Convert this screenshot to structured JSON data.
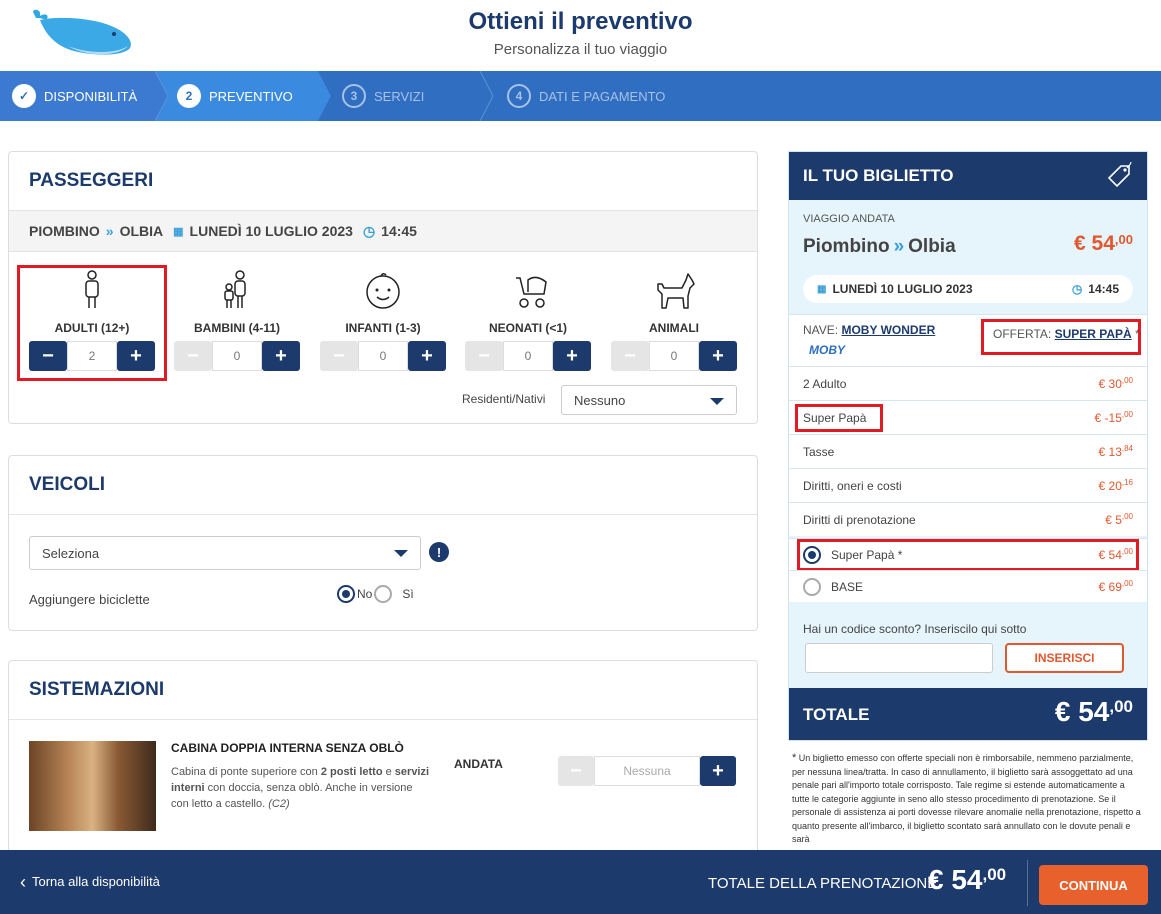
{
  "header": {
    "title": "Ottieni il preventivo",
    "subtitle": "Personalizza il tuo viaggio",
    "logo_icon": "whale-logo"
  },
  "steps": [
    {
      "num": "✓",
      "label": "DISPONIBILITÀ"
    },
    {
      "num": "2",
      "label": "PREVENTIVO"
    },
    {
      "num": "3",
      "label": "SERVIZI"
    },
    {
      "num": "4",
      "label": "DATI E PAGAMENTO"
    }
  ],
  "passengers": {
    "title": "PASSEGGERI",
    "route": {
      "from": "PIOMBINO",
      "to": "OLBIA",
      "date": "LUNEDÌ 10 LUGLIO 2023",
      "time": "14:45"
    },
    "types": [
      {
        "label": "ADULTI (12+)",
        "value": "2"
      },
      {
        "label": "BAMBINI (4-11)",
        "value": "0"
      },
      {
        "label": "INFANTI (1-3)",
        "value": "0"
      },
      {
        "label": "NEONATI (<1)",
        "value": "0"
      },
      {
        "label": "ANIMALI",
        "value": "0"
      }
    ],
    "residents_label": "Residenti/Nativi",
    "residents_value": "Nessuno"
  },
  "vehicles": {
    "title": "VEICOLI",
    "select_value": "Seleziona",
    "bikes_label": "Aggiungere biciclette",
    "no": "No",
    "si": "Sì"
  },
  "accommodations": {
    "title": "SISTEMAZIONI",
    "cabin_title": "CABINA DOPPIA INTERNA SENZA OBLÒ",
    "desc1": "Cabina di ponte superiore con ",
    "desc_b1": "2 posti letto",
    "desc2": " e ",
    "desc_b2": "servizi interni",
    "desc3": " con doccia, senza oblò. Anche in versione con letto a castello. ",
    "desc_code": "(C2)",
    "andata": "ANDATA",
    "select_value": "Nessuna"
  },
  "ticket": {
    "title": "IL TUO BIGLIETTO",
    "trip_label": "VIAGGIO ANDATA",
    "from": "Piombino",
    "to": "Olbia",
    "price_int": "€ 54",
    "price_dec": ",00",
    "date": "LUNEDÌ 10 LUGLIO 2023",
    "time": "14:45",
    "ship_label": "NAVE:",
    "ship_name": "MOBY WONDER",
    "brand": "MOBY",
    "offer_label": "OFFERTA:",
    "offer_name": "SUPER PAPÀ",
    "offer_star": "*",
    "lines": [
      {
        "label": "2 Adulto",
        "int": "€ 30",
        "dec": ",00"
      },
      {
        "label": "Super Papà",
        "int": "€ -15",
        "dec": ",00"
      },
      {
        "label": "Tasse",
        "int": "€ 13",
        "dec": ",84"
      },
      {
        "label": "Diritti, oneri e costi",
        "int": "€ 20",
        "dec": ",16"
      },
      {
        "label": "Diritti di prenotazione",
        "int": "€ 5",
        "dec": ",00"
      }
    ],
    "fares": [
      {
        "label": "Super Papà *",
        "int": "€ 54",
        "dec": ",00"
      },
      {
        "label": "BASE",
        "int": "€ 69",
        "dec": ",00"
      }
    ],
    "discount_label": "Hai un codice sconto? Inseriscilo qui sotto",
    "insert_btn": "INSERISCI",
    "total_label": "TOTALE",
    "total_int": "€ 54",
    "total_dec": ",00",
    "footnote": "Un biglietto emesso con offerte speciali non è rimborsabile, nemmeno parzialmente, per nessuna linea/tratta. In caso di annullamento, il biglietto sarà assoggettato ad una penale pari all'importo totale corrisposto. Tale regime si estende automaticamente a tutte le categorie aggiunte in seno allo stesso procedimento di prenotazione. Se il personale di assistenza ai porti dovesse rilevare anomalie nella prenotazione, rispetto a quanto presente all'imbarco, il biglietto scontato sarà annullato con le dovute penali e sarà",
    "footnote_star": "*"
  },
  "footer": {
    "back_label": "Torna alla disponibilità",
    "total_label": "TOTALE DELLA PRENOTAZIONE",
    "total_int": "€ 54",
    "total_dec": ",00",
    "continue_label": "CONTINUA"
  },
  "colors": {
    "primary": "#1d3a6c",
    "stepbar": "#2f6ec0",
    "accent": "#e0582f",
    "highlight": "#e01b24"
  }
}
